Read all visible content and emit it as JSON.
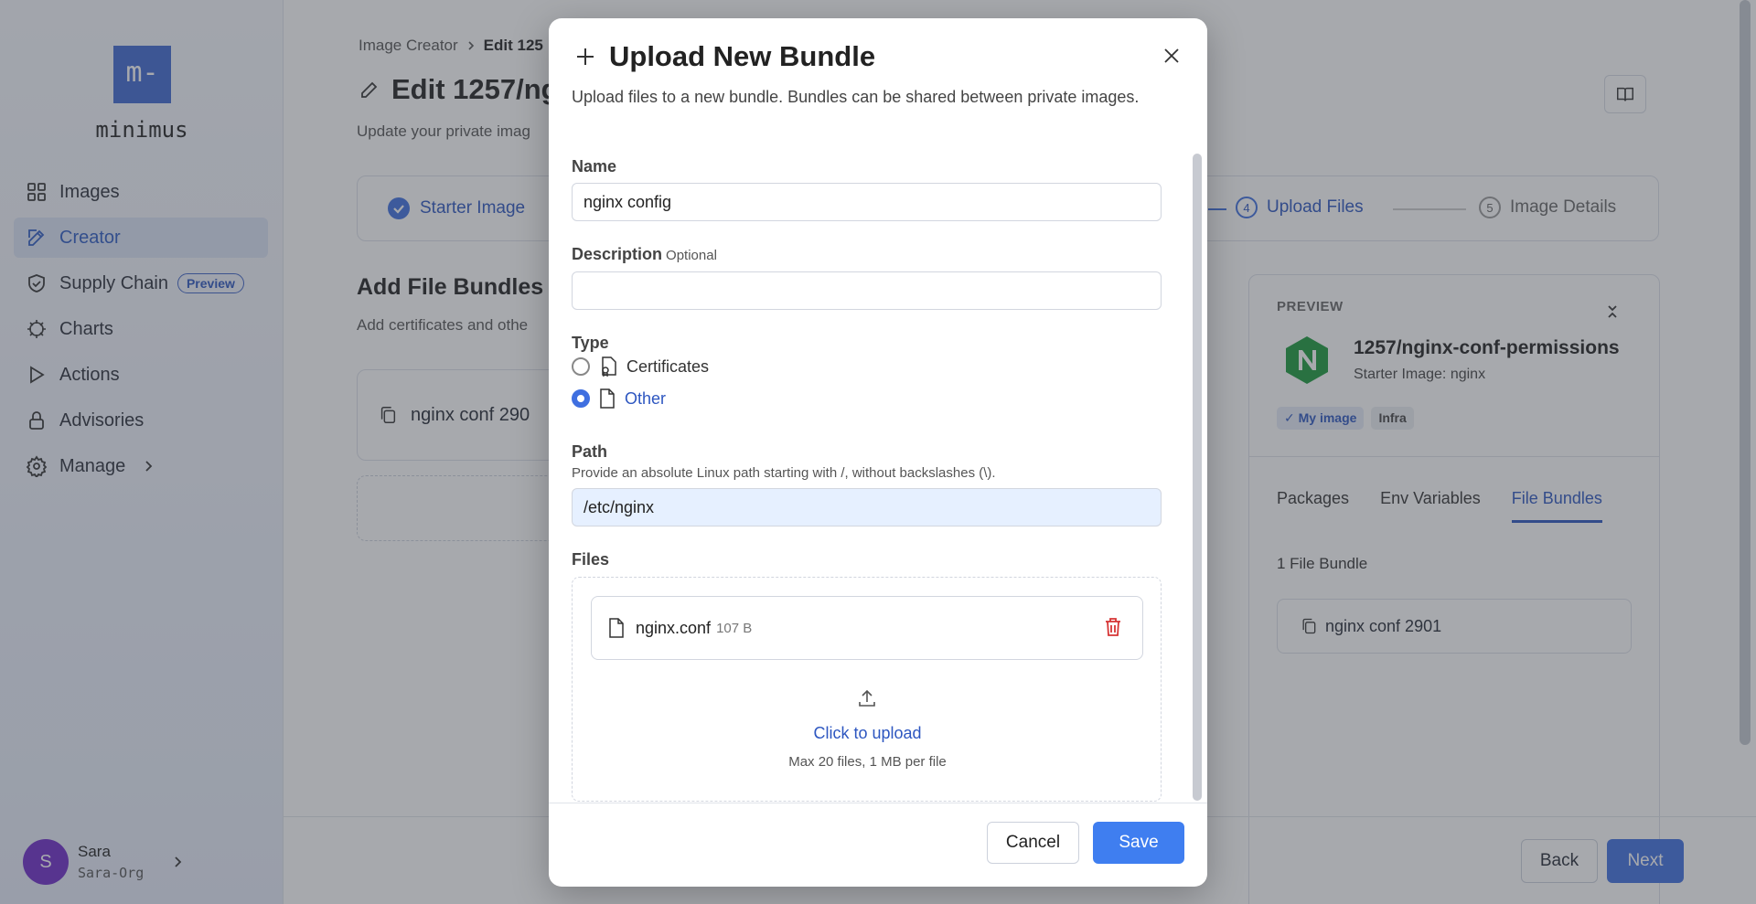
{
  "sidebar": {
    "logo_mark": "m-",
    "logo_text": "minimus",
    "items": [
      {
        "label": "Images",
        "icon": "grid-icon"
      },
      {
        "label": "Creator",
        "icon": "edit-icon"
      },
      {
        "label": "Supply Chain",
        "icon": "shield-icon",
        "badge": "Preview"
      },
      {
        "label": "Charts",
        "icon": "helm-icon"
      },
      {
        "label": "Actions",
        "icon": "play-icon"
      },
      {
        "label": "Advisories",
        "icon": "lock-icon"
      },
      {
        "label": "Manage",
        "icon": "gear-icon"
      }
    ],
    "user": {
      "initial": "S",
      "name": "Sara",
      "org": "Sara-Org"
    }
  },
  "main": {
    "breadcrumb": {
      "parent": "Image Creator",
      "current": "Edit 125"
    },
    "title": "Edit 1257/ng",
    "subtitle": "Update your private imag",
    "steps": [
      {
        "label": "Starter Image",
        "state": "done"
      },
      {
        "num": "4",
        "label": "Upload Files",
        "state": "current"
      },
      {
        "num": "5",
        "label": "Image Details",
        "state": "todo"
      }
    ],
    "section_title": "Add File Bundles",
    "section_sub": "Add certificates and othe",
    "bundle_card": "nginx conf 290",
    "preview": {
      "label": "PREVIEW",
      "name": "1257/nginx-conf-permissions",
      "starter": "Starter Image: nginx",
      "tags": [
        "My image",
        "Infra"
      ],
      "tabs": [
        "Packages",
        "Env Variables",
        "File Bundles"
      ],
      "count": "1 File Bundle",
      "bundle": "nginx conf 2901"
    },
    "back_label": "Back",
    "next_label": "Next"
  },
  "modal": {
    "title": "Upload New Bundle",
    "description": "Upload files to a new bundle. Bundles can be shared between private images.",
    "name_label": "Name",
    "name_value": "nginx config",
    "desc_label": "Description",
    "desc_optional": "Optional",
    "desc_value": "",
    "type_label": "Type",
    "type_options": [
      {
        "label": "Certificates",
        "selected": false
      },
      {
        "label": "Other",
        "selected": true
      }
    ],
    "path_label": "Path",
    "path_hint": "Provide an absolute Linux path starting with /, without backslashes (\\).",
    "path_value": "/etc/nginx",
    "files_label": "Files",
    "file": {
      "name": "nginx.conf",
      "size": "107 B"
    },
    "upload_link": "Click to upload",
    "upload_hint": "Max 20 files, 1 MB per file",
    "cancel_label": "Cancel",
    "save_label": "Save"
  },
  "colors": {
    "accent": "#3f6fe0",
    "danger": "#d63434",
    "brand": "#3f69d2"
  }
}
